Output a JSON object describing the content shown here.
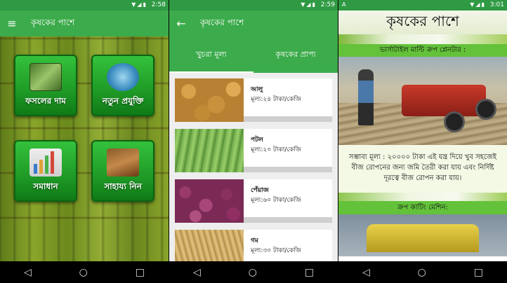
{
  "screen1": {
    "status_time": "2:58",
    "title": "কৃষকের পাশে",
    "tiles": [
      {
        "label": "ফসলের দাম",
        "icon": "money-icon"
      },
      {
        "label": "নতুন প্রযুক্তি",
        "icon": "technology-icon"
      },
      {
        "label": "সমাধান",
        "icon": "chart-icon"
      },
      {
        "label": "সাহায্য নিন",
        "icon": "gavel-icon"
      }
    ]
  },
  "screen2": {
    "status_time": "2:59",
    "title": "কৃষকের পাশে",
    "tabs": [
      "খুচরা মূল্য",
      "কৃষকের প্রাপ্য"
    ],
    "items": [
      {
        "name": "আলু",
        "price": "মূল্য:২৪ টাকা/কেজি"
      },
      {
        "name": "পটল",
        "price": "মূল্য:২০ টাকা/কেজি"
      },
      {
        "name": "পেঁয়াজ",
        "price": "মূল্য:৬০ টাকা/কেজি"
      },
      {
        "name": "গম",
        "price": "মূল্য:৩০ টাকা/কেজি"
      }
    ]
  },
  "screen3": {
    "status_time": "3:01",
    "status_badge": "A",
    "title": "কৃষকের পাশে",
    "section1_heading": "ভার্সাটাইল মাল্টি ক্রপ প্লেনটার :",
    "section1_desc": "সম্ভাব্য মূল্য : ২০০০০ টাকা এই যন্ত্র দিয়ে খুব সহজেই বীজ রোপনের জন্য জমি তৈরী করা যায় এবং নির্দিষ্ট দূরত্বে বীজ রোপন করা যায়।",
    "section2_heading": "ক্রপ কাটিং মেশিন:"
  },
  "navbar": {
    "back": "◁",
    "home": "○",
    "recent": "□"
  },
  "colors": {
    "statusbar": "#2f9a43",
    "appbar": "#3cab4b",
    "tile": "#1f9a26",
    "section_green": "#63c23a"
  }
}
